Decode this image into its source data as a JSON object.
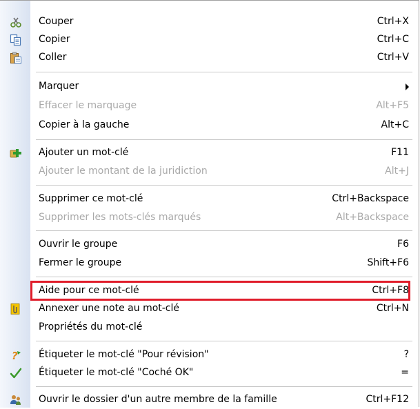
{
  "menu": {
    "items": [
      {
        "label": "Couper",
        "shortcut": "Ctrl+X",
        "icon": "scissors-icon",
        "enabled": true
      },
      {
        "label": "Copier",
        "shortcut": "Ctrl+C",
        "icon": "copy-icon",
        "enabled": true
      },
      {
        "label": "Coller",
        "shortcut": "Ctrl+V",
        "icon": "paste-icon",
        "enabled": true
      },
      {
        "label": "Marquer",
        "shortcut": "",
        "icon": "",
        "enabled": true,
        "submenu": true
      },
      {
        "label": "Effacer le marquage",
        "shortcut": "Alt+F5",
        "icon": "",
        "enabled": false
      },
      {
        "label": "Copier à la gauche",
        "shortcut": "Alt+C",
        "icon": "",
        "enabled": true
      },
      {
        "label": "Ajouter un mot-clé",
        "shortcut": "F11",
        "icon": "add-keyword-icon",
        "enabled": true
      },
      {
        "label": "Ajouter le montant de la juridiction",
        "shortcut": "Alt+J",
        "icon": "",
        "enabled": false
      },
      {
        "label": "Supprimer ce mot-clé",
        "shortcut": "Ctrl+Backspace",
        "icon": "",
        "enabled": true
      },
      {
        "label": "Supprimer les mots-clés marqués",
        "shortcut": "Alt+Backspace",
        "icon": "",
        "enabled": false
      },
      {
        "label": "Ouvrir le groupe",
        "shortcut": "F6",
        "icon": "",
        "enabled": true
      },
      {
        "label": "Fermer le groupe",
        "shortcut": "Shift+F6",
        "icon": "",
        "enabled": true
      },
      {
        "label": "Aide pour ce mot-clé",
        "shortcut": "Ctrl+F8",
        "icon": "",
        "enabled": true,
        "highlighted": true
      },
      {
        "label": "Annexer une note au mot-clé",
        "shortcut": "Ctrl+N",
        "icon": "paperclip-note-icon",
        "enabled": true
      },
      {
        "label": "Propriétés du mot-clé",
        "shortcut": "",
        "icon": "",
        "enabled": true
      },
      {
        "label": "Étiqueter le mot-clé \"Pour révision\"",
        "shortcut": "?",
        "icon": "review-flag-icon",
        "enabled": true
      },
      {
        "label": "Étiqueter le mot-clé \"Coché OK\"",
        "shortcut": "=",
        "icon": "checkmark-icon",
        "enabled": true
      },
      {
        "label": "Ouvrir le dossier d'un autre membre de la famille",
        "shortcut": "Ctrl+F12",
        "icon": "family-members-icon",
        "enabled": true
      }
    ]
  },
  "colors": {
    "highlight_border": "#e01c2a",
    "disabled_text": "#a9a9a9",
    "gutter": "#e4ebf6"
  }
}
